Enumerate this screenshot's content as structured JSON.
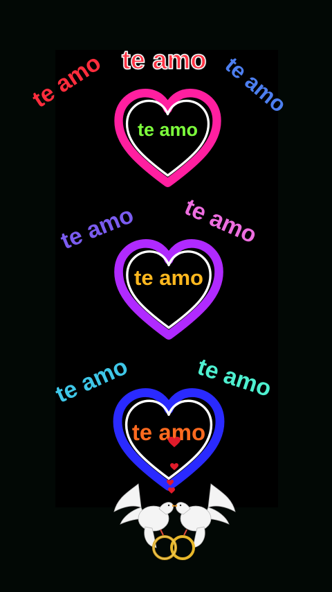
{
  "floating_texts": [
    {
      "text": "te amo",
      "color": "#ff2d3d"
    },
    {
      "text": "te amo",
      "color": "#ff3344"
    },
    {
      "text": "te amo",
      "color": "#4d7ff0"
    },
    {
      "text": "te amo",
      "color": "#7b5cf0"
    },
    {
      "text": "te amo",
      "color": "#ee6ee0"
    },
    {
      "text": "te amo",
      "color": "#3fc7e8"
    },
    {
      "text": "te amo",
      "color": "#4ef0d0"
    }
  ],
  "hearts": [
    {
      "label": "te amo",
      "stroke": "#ff1fa0",
      "label_color": "#7dff3c"
    },
    {
      "label": "te amo",
      "stroke": "#b02aff",
      "label_color": "#ffb81f"
    },
    {
      "label": "te amo",
      "stroke": "#2a2aff",
      "label_color": "#ff6a1f"
    }
  ],
  "decor": {
    "panel_color": "#000000",
    "background_color": "#020805",
    "small_heart_color": "#e01b2a"
  }
}
